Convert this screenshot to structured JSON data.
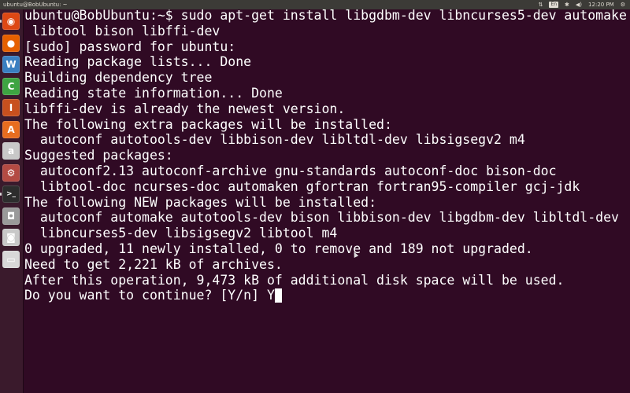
{
  "top_panel": {
    "window_title": "ubuntu@BobUbuntu: ~",
    "keyboard": "En",
    "clock": "12:20 PM"
  },
  "launcher": {
    "items": [
      {
        "name": "dash-icon",
        "glyph": "◉",
        "color": "#dd4814"
      },
      {
        "name": "firefox-icon",
        "glyph": "●",
        "color": "#e66000"
      },
      {
        "name": "libreoffice-writer-icon",
        "glyph": "W",
        "color": "#3a7fc1"
      },
      {
        "name": "libreoffice-calc-icon",
        "glyph": "C",
        "color": "#3ea442"
      },
      {
        "name": "libreoffice-impress-icon",
        "glyph": "I",
        "color": "#c8501e"
      },
      {
        "name": "software-center-icon",
        "glyph": "A",
        "color": "#e86d1f"
      },
      {
        "name": "amazon-icon",
        "glyph": "a",
        "color": "#c8c8c8"
      },
      {
        "name": "system-settings-icon",
        "glyph": "⚙",
        "color": "#b34b43"
      },
      {
        "name": "terminal-icon",
        "glyph": ">_",
        "color": "#2d2d2d"
      },
      {
        "name": "screenshot-icon",
        "glyph": "◘",
        "color": "#9a9a9a"
      },
      {
        "name": "image-viewer-icon",
        "glyph": "◙",
        "color": "#c8c8c8"
      },
      {
        "name": "disk-icon",
        "glyph": "▭",
        "color": "#d8d8d8"
      }
    ]
  },
  "terminal": {
    "lines": [
      "ubuntu@BobUbuntu:~$ sudo apt-get install libgdbm-dev libncurses5-dev automake",
      " libtool bison libffi-dev",
      "[sudo] password for ubuntu:",
      "Reading package lists... Done",
      "Building dependency tree",
      "Reading state information... Done",
      "libffi-dev is already the newest version.",
      "The following extra packages will be installed:",
      "  autoconf autotools-dev libbison-dev libltdl-dev libsigsegv2 m4",
      "Suggested packages:",
      "  autoconf2.13 autoconf-archive gnu-standards autoconf-doc bison-doc",
      "  libtool-doc ncurses-doc automaken gfortran fortran95-compiler gcj-jdk",
      "The following NEW packages will be installed:",
      "  autoconf automake autotools-dev bison libbison-dev libgdbm-dev libltdl-dev",
      "  libncurses5-dev libsigsegv2 libtool m4",
      "0 upgraded, 11 newly installed, 0 to remove and 189 not upgraded.",
      "Need to get 2,221 kB of archives.",
      "After this operation, 9,473 kB of additional disk space will be used."
    ],
    "prompt": "Do you want to continue? [Y/n] ",
    "input": "Y"
  }
}
